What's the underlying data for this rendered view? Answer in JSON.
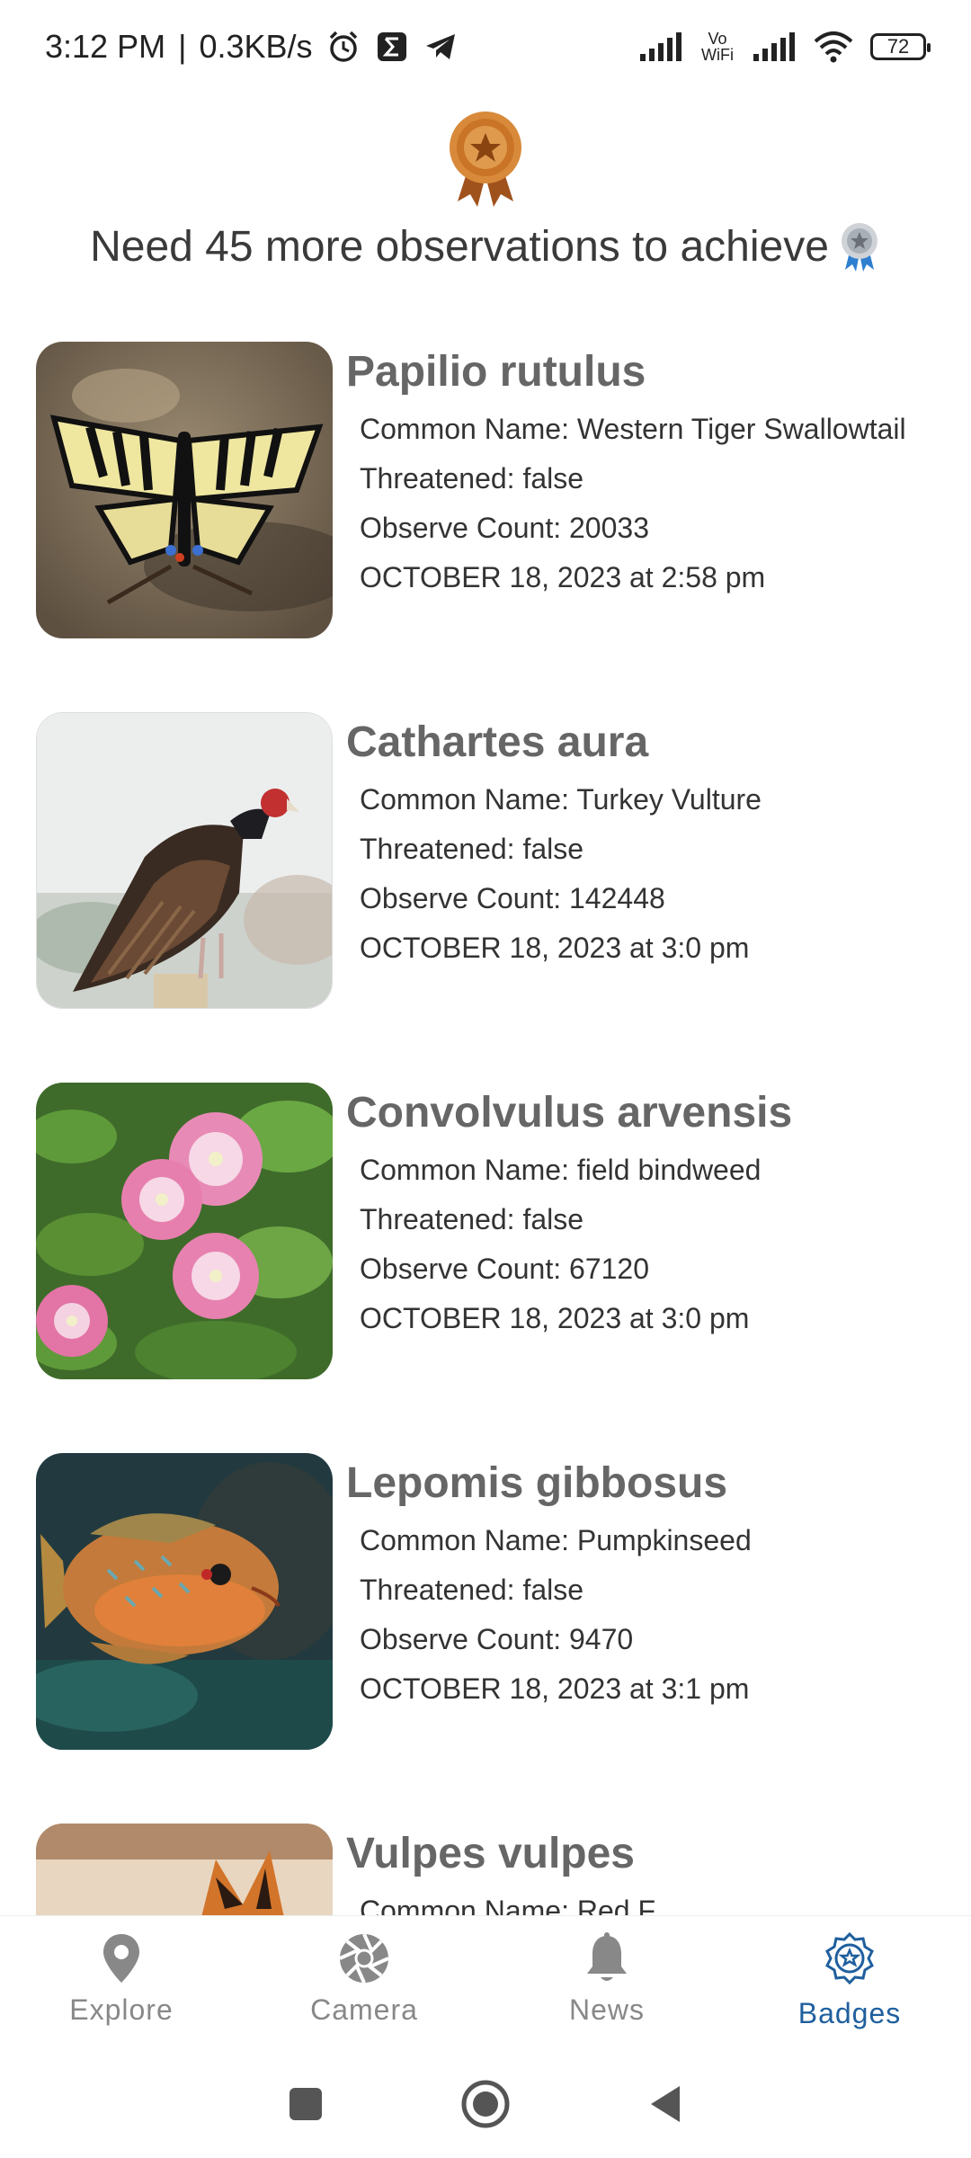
{
  "status_bar": {
    "time": "3:12 PM",
    "speed": "0.3KB/s",
    "separator": "|",
    "vowifi": "Vo WiFi",
    "battery": "72"
  },
  "header": {
    "goal_text": "Need 45 more observations to achieve"
  },
  "observations": [
    {
      "scientific_name": "Papilio rutulus",
      "common_name": "Common Name: Western Tiger Swallowtail",
      "threatened": "Threatened: false",
      "observe_count": "Observe Count: 20033",
      "date": "OCTOBER 18, 2023 at 2:58 pm"
    },
    {
      "scientific_name": "Cathartes aura",
      "common_name": "Common Name: Turkey Vulture",
      "threatened": "Threatened: false",
      "observe_count": "Observe Count: 142448",
      "date": "OCTOBER 18, 2023 at 3:0 pm"
    },
    {
      "scientific_name": "Convolvulus arvensis",
      "common_name": "Common Name: field bindweed",
      "threatened": "Threatened: false",
      "observe_count": "Observe Count: 67120",
      "date": "OCTOBER 18, 2023 at 3:0 pm"
    },
    {
      "scientific_name": "Lepomis gibbosus",
      "common_name": "Common Name: Pumpkinseed",
      "threatened": "Threatened: false",
      "observe_count": "Observe Count: 9470",
      "date": "OCTOBER 18, 2023 at 3:1 pm"
    },
    {
      "scientific_name": "Vulpes vulpes",
      "common_name": "Common Name: Red F"
    }
  ],
  "bottom_nav": {
    "items": [
      {
        "label": "Explore",
        "icon": "map-pin-icon"
      },
      {
        "label": "Camera",
        "icon": "camera-aperture-icon"
      },
      {
        "label": "News",
        "icon": "bell-icon"
      },
      {
        "label": "Badges",
        "icon": "badge-icon"
      }
    ],
    "active": "Badges"
  },
  "colors": {
    "active_nav": "#1f5f9e",
    "inactive_nav": "#888888",
    "title_gray": "#666666"
  }
}
